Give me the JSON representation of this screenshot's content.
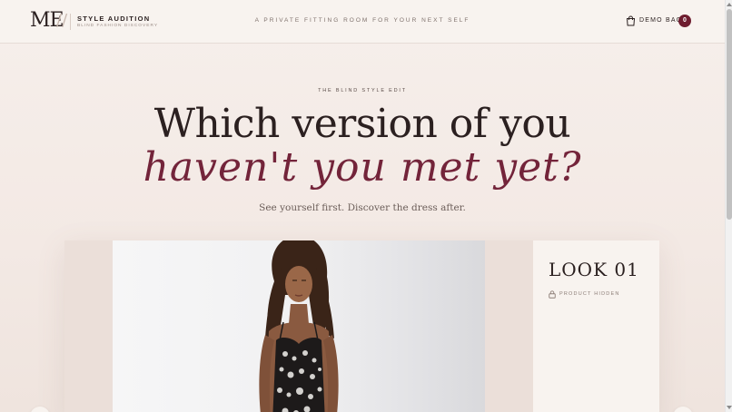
{
  "header": {
    "logo": "ME",
    "logo_slash": "//",
    "brand_name": "STYLE AUDITION",
    "brand_sub": "BLIND FASHION DISCOVERY",
    "tagline": "A PRIVATE FITTING ROOM FOR YOUR NEXT SELF",
    "bag_label": "DEMO BAG",
    "bag_count": "0"
  },
  "hero": {
    "eyebrow": "THE BLIND STYLE EDIT",
    "headline_line1": "Which version of you",
    "headline_line2": "haven't you met yet?",
    "subline": "See yourself first. Discover the dress after."
  },
  "look": {
    "title": "LOOK 01",
    "status": "PRODUCT HIDDEN"
  },
  "colors": {
    "accent": "#6e1d2f",
    "headline_accent": "#73243a",
    "background": "#f3e9e4"
  },
  "icons": [
    "bag-icon",
    "lock-icon",
    "chevron-left-icon",
    "chevron-right-icon"
  ]
}
